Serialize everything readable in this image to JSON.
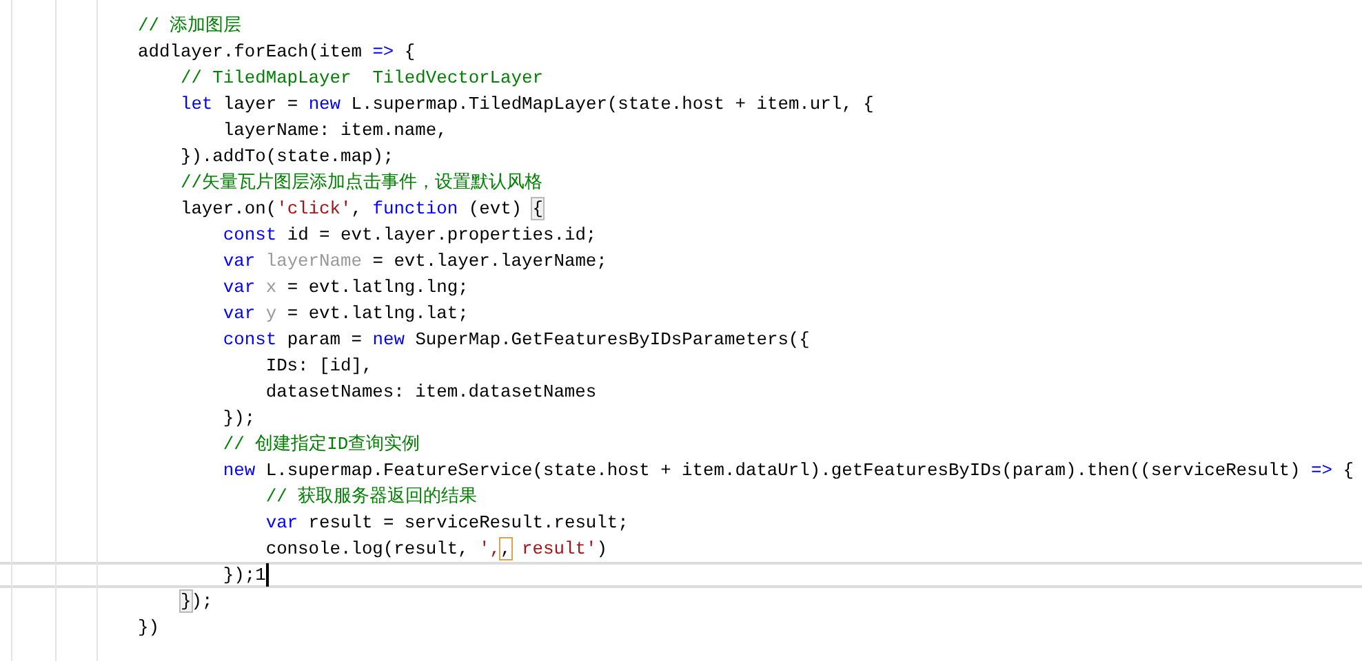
{
  "editor": {
    "lines": [
      {
        "current": false,
        "tokens": [
          {
            "text": "// 添加图层",
            "kind": "comment"
          }
        ]
      },
      {
        "current": false,
        "tokens": [
          {
            "text": "addlayer.forEach(item ",
            "kind": "plain"
          },
          {
            "text": "=>",
            "kind": "keyword"
          },
          {
            "text": " {",
            "kind": "plain"
          }
        ]
      },
      {
        "current": false,
        "tokens": [
          {
            "text": "    // TiledMapLayer  TiledVectorLayer",
            "kind": "comment"
          }
        ]
      },
      {
        "current": false,
        "tokens": [
          {
            "text": "    let",
            "kind": "keyword"
          },
          {
            "text": " layer = ",
            "kind": "plain"
          },
          {
            "text": "new",
            "kind": "keyword"
          },
          {
            "text": " L.supermap.TiledMapLayer(state.host + item.url, {",
            "kind": "plain"
          }
        ]
      },
      {
        "current": false,
        "tokens": [
          {
            "text": "        layerName: item.name,",
            "kind": "plain"
          }
        ]
      },
      {
        "current": false,
        "tokens": [
          {
            "text": "    }).addTo(state.map);",
            "kind": "plain"
          }
        ]
      },
      {
        "current": false,
        "tokens": [
          {
            "text": "    //矢量瓦片图层添加点击事件，设置默认风格",
            "kind": "comment"
          }
        ]
      },
      {
        "current": false,
        "tokens": [
          {
            "text": "    layer.on(",
            "kind": "plain"
          },
          {
            "text": "'click'",
            "kind": "string"
          },
          {
            "text": ", ",
            "kind": "plain"
          },
          {
            "text": "function",
            "kind": "keyword"
          },
          {
            "text": " (evt) ",
            "kind": "plain"
          },
          {
            "text": "{",
            "kind": "match"
          }
        ]
      },
      {
        "current": false,
        "tokens": [
          {
            "text": "        const",
            "kind": "keyword"
          },
          {
            "text": " id = evt.layer.properties.id;",
            "kind": "plain"
          }
        ]
      },
      {
        "current": false,
        "tokens": [
          {
            "text": "        var ",
            "kind": "keyword"
          },
          {
            "text": "layerName",
            "kind": "unused"
          },
          {
            "text": " = evt.layer.layerName;",
            "kind": "plain"
          }
        ]
      },
      {
        "current": false,
        "tokens": [
          {
            "text": "        var ",
            "kind": "keyword"
          },
          {
            "text": "x",
            "kind": "unused"
          },
          {
            "text": " = evt.latlng.lng;",
            "kind": "plain"
          }
        ]
      },
      {
        "current": false,
        "tokens": [
          {
            "text": "        var ",
            "kind": "keyword"
          },
          {
            "text": "y",
            "kind": "unused"
          },
          {
            "text": " = evt.latlng.lat;",
            "kind": "plain"
          }
        ]
      },
      {
        "current": false,
        "tokens": [
          {
            "text": "        const",
            "kind": "keyword"
          },
          {
            "text": " param = ",
            "kind": "plain"
          },
          {
            "text": "new",
            "kind": "keyword"
          },
          {
            "text": " SuperMap.GetFeaturesByIDsParameters({",
            "kind": "plain"
          }
        ]
      },
      {
        "current": false,
        "tokens": [
          {
            "text": "            IDs: [id],",
            "kind": "plain"
          }
        ]
      },
      {
        "current": false,
        "tokens": [
          {
            "text": "            datasetNames: item.datasetNames",
            "kind": "plain"
          }
        ]
      },
      {
        "current": false,
        "tokens": [
          {
            "text": "        });",
            "kind": "plain"
          }
        ]
      },
      {
        "current": false,
        "tokens": [
          {
            "text": "        // 创建指定ID查询实例",
            "kind": "comment"
          }
        ]
      },
      {
        "current": false,
        "tokens": [
          {
            "text": "        new",
            "kind": "keyword"
          },
          {
            "text": " L.supermap.FeatureService(state.host + item.dataUrl).getFeaturesByIDs(param).then((serviceResult) ",
            "kind": "plain"
          },
          {
            "text": "=>",
            "kind": "keyword"
          },
          {
            "text": " {",
            "kind": "plain"
          }
        ]
      },
      {
        "current": false,
        "tokens": [
          {
            "text": "            // 获取服务器返回的结果",
            "kind": "comment"
          }
        ]
      },
      {
        "current": false,
        "tokens": [
          {
            "text": "            var",
            "kind": "keyword"
          },
          {
            "text": " result = serviceResult.result;",
            "kind": "plain"
          }
        ]
      },
      {
        "current": false,
        "tokens": [
          {
            "text": "            console.log(result, ",
            "kind": "plain"
          },
          {
            "text": "',",
            "kind": "string"
          },
          {
            "text": ",",
            "kind": "highlight"
          },
          {
            "text": " result'",
            "kind": "string"
          },
          {
            "text": ")",
            "kind": "plain"
          }
        ]
      },
      {
        "current": true,
        "tokens": [
          {
            "text": "        });1",
            "kind": "plain"
          }
        ]
      },
      {
        "current": false,
        "tokens": [
          {
            "text": "    }",
            "kind": "match"
          },
          {
            "text": ");",
            "kind": "plain"
          }
        ]
      },
      {
        "current": false,
        "tokens": [
          {
            "text": "})",
            "kind": "plain"
          }
        ]
      }
    ]
  }
}
